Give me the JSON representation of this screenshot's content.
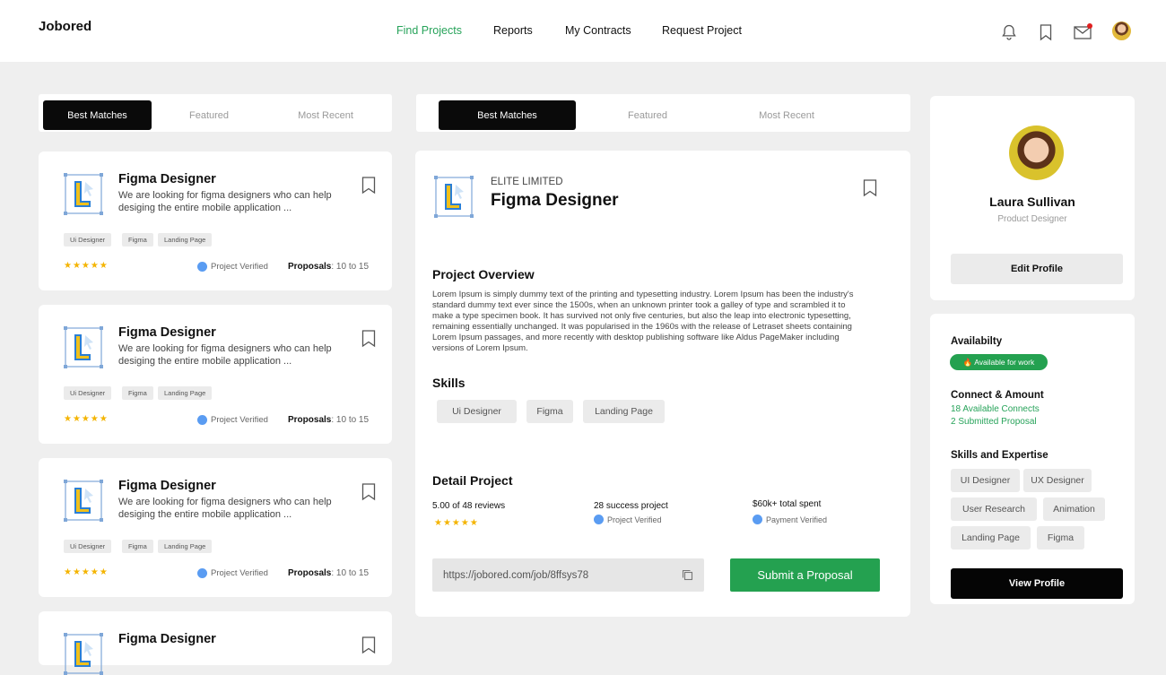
{
  "app": {
    "brand": "Jobored"
  },
  "nav": [
    "Find Projects",
    "Reports",
    "My Contracts",
    "Request Project"
  ],
  "tabs_left": [
    "Best Matches",
    "Featured",
    "Most Recent"
  ],
  "tabs_mid": [
    "Best Matches",
    "Featured",
    "Most Recent"
  ],
  "jobs": [
    {
      "title": "Figma Designer",
      "desc": "We are looking for figma designers who can help desiging the entire mobile application ...",
      "tags": [
        "Ui Designer",
        "Figma",
        "Landing Page"
      ],
      "stars": "★★★★★",
      "verified": "Project Verified",
      "proposals_label": "Proposals",
      "proposals_value": ": 10 to 15"
    },
    {
      "title": "Figma Designer",
      "desc": "We are looking for figma designers who can help desiging the entire mobile application ...",
      "tags": [
        "Ui Designer",
        "Figma",
        "Landing Page"
      ],
      "stars": "★★★★★",
      "verified": "Project Verified",
      "proposals_label": "Proposals",
      "proposals_value": ": 10 to 15"
    },
    {
      "title": "Figma Designer",
      "desc": "We are looking for figma designers who can help desiging the entire mobile application ...",
      "tags": [
        "Ui Designer",
        "Figma",
        "Landing Page"
      ],
      "stars": "★★★★★",
      "verified": "Project Verified",
      "proposals_label": "Proposals",
      "proposals_value": ": 10 to 15"
    },
    {
      "title": "Figma Designer"
    }
  ],
  "detail": {
    "company": "ELITE LIMITED",
    "title": "Figma Designer",
    "overview_h": "Project Overview",
    "overview": "Lorem Ipsum is simply dummy text of the printing and typesetting industry. Lorem Ipsum has been the industry's standard dummy text ever since the 1500s, when an unknown printer took a galley of type and scrambled it to make a type specimen book. It has survived not only five centuries, but also the leap into electronic typesetting, remaining essentially unchanged. It was popularised in the 1960s with the release of Letraset sheets containing Lorem Ipsum passages, and more recently with desktop publishing software like Aldus PageMaker including versions of Lorem Ipsum.",
    "skills_h": "Skills",
    "skills": [
      "Ui Designer",
      "Figma",
      "Landing Page"
    ],
    "detail_h": "Detail Project",
    "reviews": "5.00 of 48 reviews",
    "stars": "★★★★★",
    "success": "28 success project",
    "project_verified": "Project Verified",
    "spent": "$60k+ total spent",
    "payment_verified": "Payment Verified",
    "url": "https://jobored.com/job/8ffsys78",
    "submit": "Submit a Proposal"
  },
  "profile": {
    "name": "Laura Sullivan",
    "role": "Product Designer",
    "edit": "Edit Profile",
    "availability_h": "Availabilty",
    "availability_badge": "🔥 Available for work",
    "connect_h": "Connect & Amount",
    "connects": "18 Available Connects",
    "submitted": "2 Submitted Proposal",
    "skills_h": "Skills and Expertise",
    "skills": [
      "UI Designer",
      "UX Designer",
      "User Research",
      "Animation",
      "Landing Page",
      "Figma"
    ],
    "view": "View Profile"
  },
  "colors": {
    "accent": "#27a35a",
    "button_green": "#24a150",
    "dark": "#0a0a0a",
    "notification_dot": "#e02020"
  }
}
